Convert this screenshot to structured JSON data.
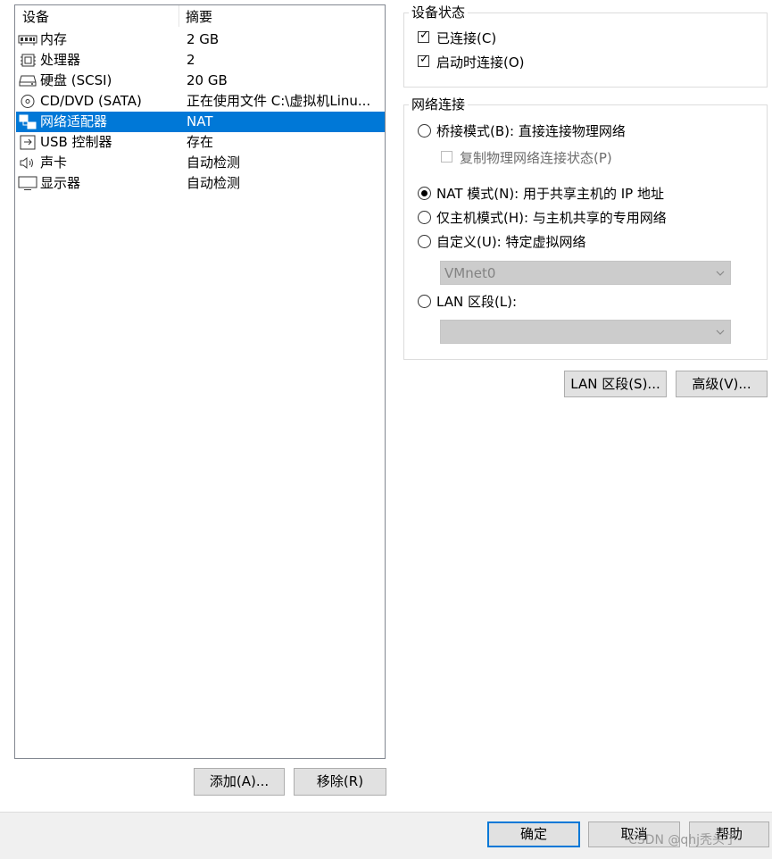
{
  "device_list": {
    "headers": {
      "device": "设备",
      "summary": "摘要"
    },
    "rows": [
      {
        "name": "内存",
        "summary": "2 GB",
        "icon": "memory-icon"
      },
      {
        "name": "处理器",
        "summary": "2",
        "icon": "processor-icon"
      },
      {
        "name": "硬盘 (SCSI)",
        "summary": "20 GB",
        "icon": "hard-disk-icon"
      },
      {
        "name": "CD/DVD (SATA)",
        "summary": "正在使用文件 C:\\虚拟机Linu...",
        "icon": "cd-dvd-icon"
      },
      {
        "name": "网络适配器",
        "summary": "NAT",
        "icon": "network-adapter-icon",
        "selected": true
      },
      {
        "name": "USB 控制器",
        "summary": "存在",
        "icon": "usb-icon"
      },
      {
        "name": "声卡",
        "summary": "自动检测",
        "icon": "sound-card-icon"
      },
      {
        "name": "显示器",
        "summary": "自动检测",
        "icon": "display-icon"
      }
    ]
  },
  "list_buttons": {
    "add": "添加(A)...",
    "remove": "移除(R)"
  },
  "device_status": {
    "title": "设备状态",
    "connected": {
      "label": "已连接(C)",
      "checked": true
    },
    "connect_on_power": {
      "label": "启动时连接(O)",
      "checked": true
    }
  },
  "network": {
    "title": "网络连接",
    "bridged": {
      "label": "桥接模式(B): 直接连接物理网络"
    },
    "replicate": {
      "label": "复制物理网络连接状态(P)"
    },
    "nat": {
      "label": "NAT 模式(N): 用于共享主机的 IP 地址",
      "selected": true
    },
    "host_only": {
      "label": "仅主机模式(H): 与主机共享的专用网络"
    },
    "custom": {
      "label": "自定义(U): 特定虚拟网络",
      "select_value": "VMnet0"
    },
    "lan_segment": {
      "label": "LAN 区段(L):",
      "select_value": ""
    }
  },
  "action_buttons": {
    "lan_segments": "LAN 区段(S)...",
    "advanced": "高级(V)..."
  },
  "dialog_buttons": {
    "ok": "确定",
    "cancel": "取消",
    "help": "帮助"
  },
  "watermark": "CSDN @qhj秃头了",
  "colors": {
    "selection": "#0078d7",
    "button_bg": "#e1e1e1",
    "disabled_select": "#cccccc"
  }
}
